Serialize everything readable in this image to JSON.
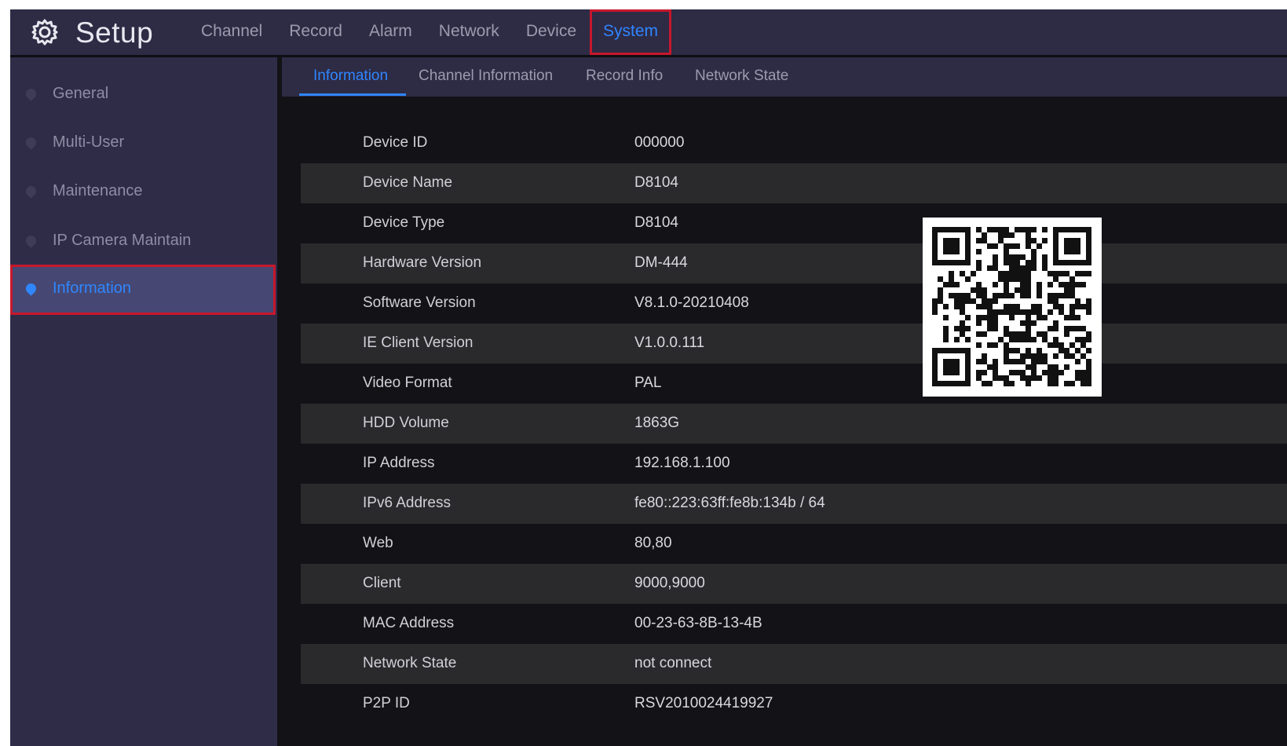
{
  "app": {
    "title": "Setup"
  },
  "topnav": [
    "Channel",
    "Record",
    "Alarm",
    "Network",
    "Device",
    "System"
  ],
  "sidebar": [
    "General",
    "Multi-User",
    "Maintenance",
    "IP Camera Maintain",
    "Information"
  ],
  "subtabs": [
    "Information",
    "Channel Information",
    "Record Info",
    "Network State"
  ],
  "info": [
    {
      "key": "Device ID",
      "value": "000000"
    },
    {
      "key": "Device Name",
      "value": "D8104"
    },
    {
      "key": "Device Type",
      "value": "D8104"
    },
    {
      "key": "Hardware Version",
      "value": "DM-444"
    },
    {
      "key": "Software Version",
      "value": "V8.1.0-20210408"
    },
    {
      "key": "IE Client Version",
      "value": "V1.0.0.111"
    },
    {
      "key": "Video Format",
      "value": "PAL"
    },
    {
      "key": "HDD Volume",
      "value": "1863G"
    },
    {
      "key": "IP Address",
      "value": "192.168.1.100"
    },
    {
      "key": "IPv6 Address",
      "value": "fe80::223:63ff:fe8b:134b / 64"
    },
    {
      "key": "Web",
      "value": "80,80"
    },
    {
      "key": "Client",
      "value": "9000,9000"
    },
    {
      "key": "MAC Address",
      "value": "00-23-63-8B-13-4B"
    },
    {
      "key": "Network State",
      "value": "not connect"
    },
    {
      "key": "P2P ID",
      "value": "RSV2010024419927"
    }
  ],
  "active": {
    "topnav": "System",
    "sidebar": "Information",
    "subtab": "Information"
  },
  "colors": {
    "accent": "#2f86ff",
    "highlight": "#c7172c",
    "bar": "#2e2b45",
    "sidebar": "#2f2c48"
  },
  "icons": {
    "logo": "gear-icon",
    "sidebar_bullet": "map-pin-icon",
    "qr": "qr-code"
  }
}
